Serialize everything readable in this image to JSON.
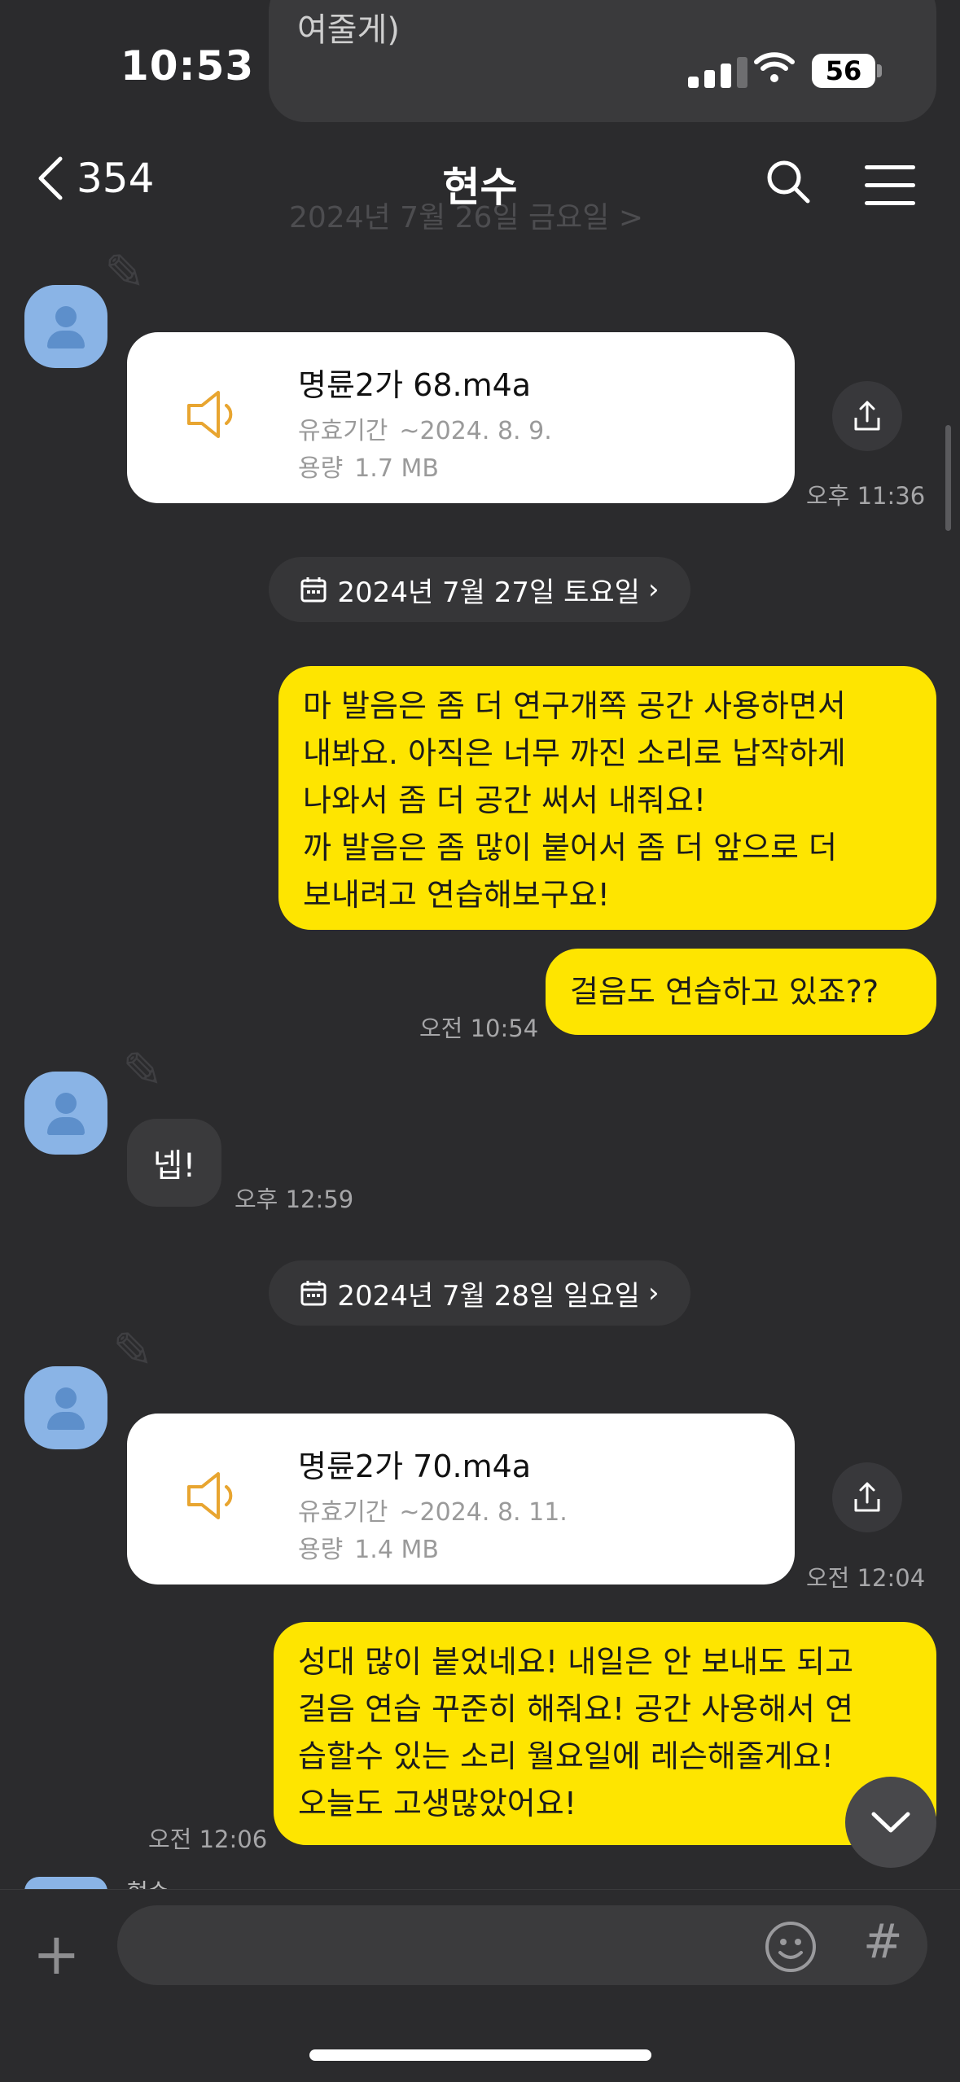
{
  "status": {
    "time": "10:53",
    "battery": "56"
  },
  "peek": {
    "text": "여줄게)"
  },
  "header": {
    "back_count": "354",
    "title": "현수"
  },
  "ghost_date": "2024년 7월 26일 금요일 >",
  "messages": {
    "file1": {
      "name": "명륜2가 68.m4a",
      "expiry_label": "유효기간",
      "expiry_value": "~2024. 8. 9.",
      "size_label": "용량",
      "size_value": "1.7 MB",
      "time": "오후 11:36"
    },
    "date1": "2024년 7월 27일 토요일",
    "me1": {
      "lines": [
        "마 발음은 좀 더 연구개쪽 공간 사용하면서",
        "내봐요. 아직은 너무 까진 소리로 납작하게",
        "나와서 좀 더 공간 써서 내줘요!",
        "까 발음은 좀 많이 붙어서 좀 더 앞으로 더",
        "보내려고 연습해보구요!"
      ]
    },
    "me2": {
      "text": "걸음도 연습하고 있죠??",
      "time": "오전 10:54"
    },
    "other1": {
      "text": "넵!",
      "time": "오후 12:59"
    },
    "date2": "2024년 7월 28일 일요일",
    "file2": {
      "name": "명륜2가 70.m4a",
      "expiry_label": "유효기간",
      "expiry_value": "~2024. 8. 11.",
      "size_label": "용량",
      "size_value": "1.4 MB",
      "time": "오전 12:04"
    },
    "me3": {
      "lines": [
        "성대 많이 붙었네요! 내일은 안 보내도 되고",
        "걸음 연습 꾸준히 해줘요! 공간 사용해서 연",
        "습할수 있는 소리 월요일에 레슨해줄게요!",
        "오늘도 고생많았어요!"
      ],
      "time": "오전 12:06"
    },
    "partial_name": "현수"
  },
  "colors": {
    "bubble_me": "#fee500",
    "background": "#2b2b2d",
    "speaker_icon": "#e8a530",
    "avatar": "#8ab4e6"
  },
  "icons": [
    "back-chevron-icon",
    "search-icon",
    "menu-icon",
    "speaker-icon",
    "share-icon",
    "calendar-icon",
    "chevron-down-icon",
    "plus-icon",
    "emoji-icon",
    "hash-icon"
  ]
}
